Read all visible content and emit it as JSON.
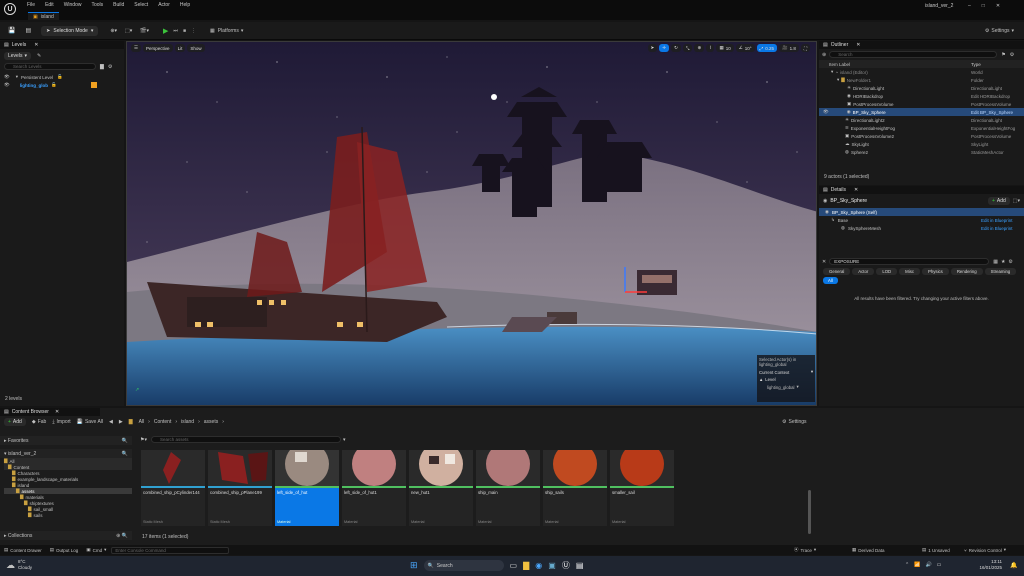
{
  "titlebar": {
    "project_title": "island_ver_2",
    "menu": [
      "File",
      "Edit",
      "Window",
      "Tools",
      "Build",
      "Select",
      "Actor",
      "Help"
    ],
    "tab_label": "island"
  },
  "toolbar": {
    "selection_mode": "Selection Mode",
    "platforms": "Platforms",
    "settings": "Settings"
  },
  "levels": {
    "title": "Levels",
    "dropdown": "Levels",
    "search_placeholder": "Search Levels",
    "items": [
      {
        "label": "Persistent Level"
      },
      {
        "label": "lighting_glob"
      }
    ],
    "footer": "2 levels"
  },
  "viewport": {
    "perspective": "Perspective",
    "lit": "Lit",
    "show": "Show",
    "grid_snap": "10",
    "rot_snap": "10°",
    "scale_snap": "0.25",
    "cam_speed": "1.8",
    "selected_label": "Selected Actor(s) in",
    "selected_level": "lighting_global",
    "current_context": "Current Context",
    "level_label": "Level",
    "level_value": "lighting_global"
  },
  "outliner": {
    "title": "Outliner",
    "search_placeholder": "Search",
    "col_label": "Item Label",
    "col_type": "Type",
    "rows": [
      {
        "label": "island (Editor)",
        "type": "World"
      },
      {
        "label": "NewFolder1",
        "type": "Folder"
      },
      {
        "label": "DirectionalLight",
        "type": "DirectionalLight"
      },
      {
        "label": "HDRIBackdrop",
        "type": "Edit HDRIBackdrop"
      },
      {
        "label": "PostProcessVolume",
        "type": "PostProcessVolume"
      },
      {
        "label": "BP_Sky_Sphere",
        "type": "Edit BP_Sky_Sphere"
      },
      {
        "label": "DirectionalLight2",
        "type": "DirectionalLight"
      },
      {
        "label": "ExponentialHeightFog",
        "type": "ExponentialHeightFog"
      },
      {
        "label": "PostProcessVolume2",
        "type": "PostProcessVolume"
      },
      {
        "label": "SkyLight",
        "type": "SkyLight"
      },
      {
        "label": "Sphere2",
        "type": "StaticMeshActor"
      }
    ],
    "footer": "9 actors (1 selected)"
  },
  "details": {
    "title": "Details",
    "actor": "BP_Sky_Sphere",
    "add": "Add",
    "self_row": "BP_Sky_Sphere (Self)",
    "base": "Base",
    "mesh": "SkySphereMesh",
    "edit_bp": "Edit in Blueprint",
    "filter_value": "EXPOSURE",
    "tabs": [
      "General",
      "Actor",
      "LOD",
      "Misc",
      "Physics",
      "Rendering",
      "Streaming"
    ],
    "all_tab": "All",
    "message": "All results have been filtered. Try changing your active filters above."
  },
  "content_browser": {
    "title": "Content Browser",
    "add": "Add",
    "fab": "Fab",
    "import": "Import",
    "save_all": "Save All",
    "path": [
      "All",
      "Content",
      "island",
      "assets"
    ],
    "settings": "Settings",
    "favorites": "Favorites",
    "project": "island_ver_2",
    "search_placeholder": "Search assets",
    "tree": [
      "All",
      "Content",
      "Characters",
      "example_landscape_materials",
      "island",
      "assets",
      "materials",
      "shiptextures",
      "sail_small",
      "sails"
    ],
    "collections": "Collections",
    "assets": [
      {
        "name": "combined_ship_pCylinder144",
        "type": "Static Mesh"
      },
      {
        "name": "combined_ship_pPlane199",
        "type": "Static Mesh"
      },
      {
        "name": "left_side_of_hut",
        "type": "Material"
      },
      {
        "name": "left_side_of_hut1",
        "type": "Material"
      },
      {
        "name": "new_hut1",
        "type": "Material"
      },
      {
        "name": "ship_main",
        "type": "Material"
      },
      {
        "name": "ship_sails",
        "type": "Material"
      },
      {
        "name": "smaller_sail",
        "type": "Material"
      }
    ],
    "footer": "17 items (1 selected)"
  },
  "statusbar": {
    "content_drawer": "Content Drawer",
    "output_log": "Output Log",
    "cmd": "Cmd",
    "console_placeholder": "Enter Console Command",
    "trace": "Trace",
    "derived_data": "Derived Data",
    "unsaved": "1 Unsaved",
    "revision": "Revision Control"
  },
  "taskbar": {
    "temp": "8°C",
    "weather": "Cloudy",
    "search": "Search",
    "time": "13:11",
    "date": "16/01/2025"
  },
  "colors": {
    "accent": "#0a78e6",
    "selection": "#264a7a",
    "link": "#3aa0ff"
  }
}
